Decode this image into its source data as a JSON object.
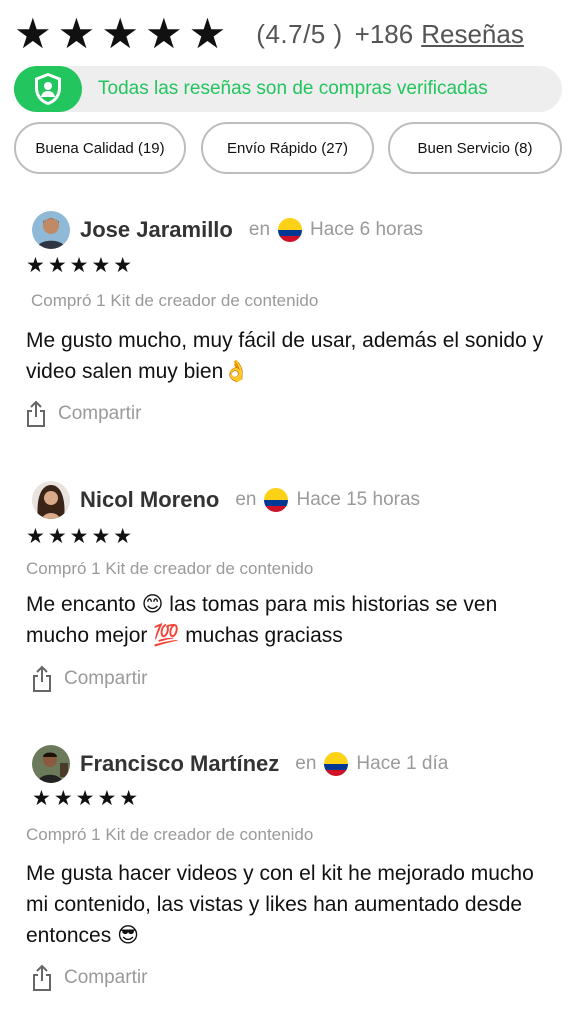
{
  "summary": {
    "stars": [
      "★",
      "★",
      "★",
      "★",
      "★"
    ],
    "rating": "(4.7/5 )",
    "count": "+186",
    "reviews_link": "Reseñas"
  },
  "verified": {
    "icon": "shield-user-icon",
    "text": "Todas las reseñas son de compras verificadas",
    "color": "#22c55e"
  },
  "filters": [
    {
      "label": "Buena Calidad (19)"
    },
    {
      "label": "Envío Rápido (27)"
    },
    {
      "label": "Buen Servicio (8)"
    }
  ],
  "reviews": [
    {
      "name": "Jose Jaramillo",
      "en": "en",
      "country_flag": "colombia-flag-icon",
      "time": "Hace 6 horas",
      "stars": "★★★★★",
      "bought": "Compró 1 Kit de creador de contenido",
      "text": "Me gusto mucho, muy fácil de usar, además el sonido y video salen muy bien👌",
      "share": "Compartir"
    },
    {
      "name": "Nicol Moreno",
      "en": "en",
      "country_flag": "colombia-flag-icon",
      "time": "Hace 15 horas",
      "stars": "★★★★★",
      "bought": "Compró 1 Kit de creador de contenido",
      "text": "Me encanto 😊 las tomas para mis historias se ven mucho mejor 💯 muchas graciass",
      "share": "Compartir"
    },
    {
      "name": "Francisco Martínez",
      "en": "en",
      "country_flag": "colombia-flag-icon",
      "time": "Hace 1 día",
      "stars": "★★★★★",
      "bought": "Compró 1 Kit de creador de contenido",
      "text": "Me gusta hacer videos y con el kit he mejorado mucho mi contenido, las vistas y likes han aumentado desde entonces 😎",
      "share": "Compartir"
    }
  ]
}
